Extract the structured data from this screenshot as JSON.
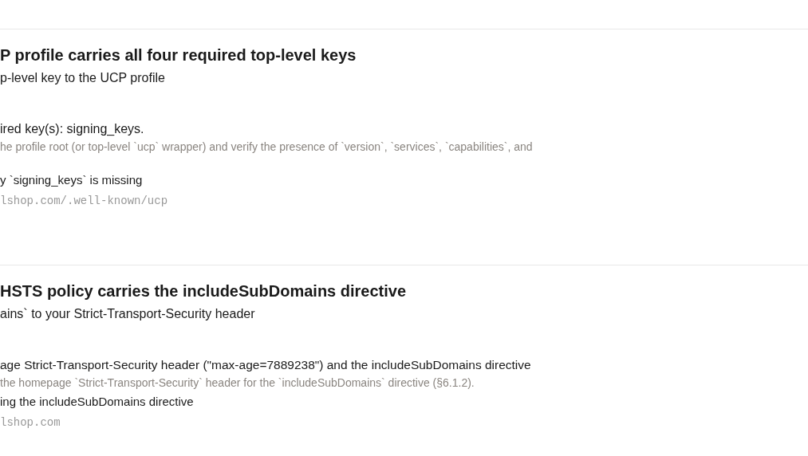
{
  "checks": [
    {
      "title": "P profile carries all four required top-level keys",
      "fix": "p-level key to the UCP profile",
      "finding": "ired key(s): signing_keys.",
      "method": "he profile root (or top-level `ucp` wrapper) and verify the presence of `version`, `services`, `capabilities`, and",
      "result": "y `signing_keys` is missing",
      "url": "lshop.com/.well-known/ucp"
    },
    {
      "title": "HSTS policy carries the includeSubDomains directive",
      "fix": "ains` to your Strict-Transport-Security header",
      "finding": "age Strict-Transport-Security header (\"max-age=7889238\") and the includeSubDomains directive",
      "method": "the homepage `Strict-Transport-Security` header for the `includeSubDomains` directive (§6.1.2).",
      "result": "ing the includeSubDomains directive",
      "url": "lshop.com"
    }
  ]
}
